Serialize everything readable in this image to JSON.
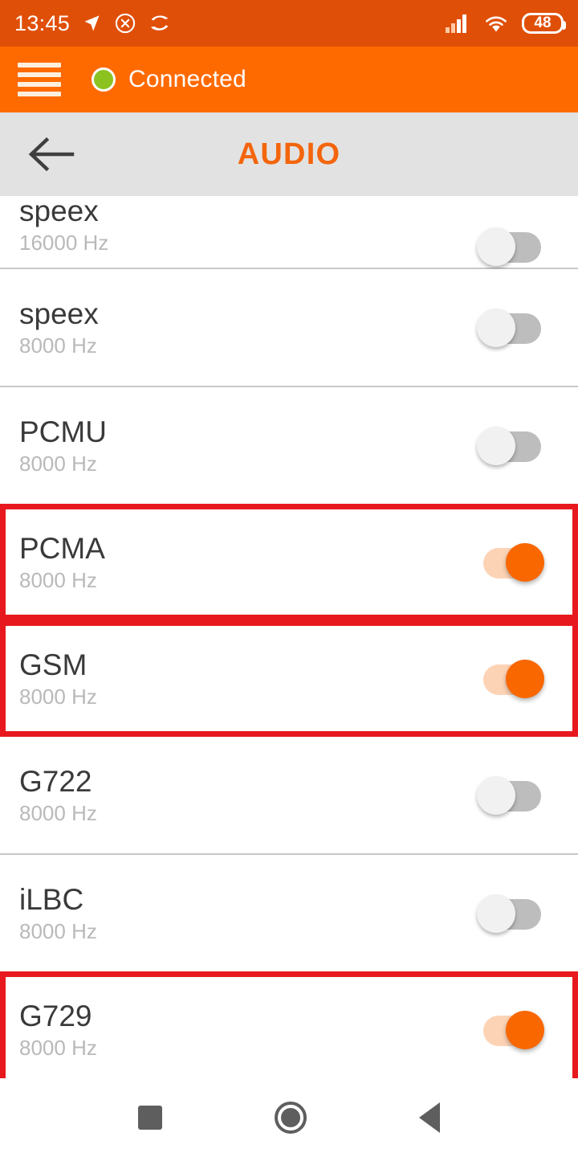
{
  "status_bar": {
    "time": "13:45",
    "left_icons": [
      "location-arrow-icon",
      "cancel-circle-icon",
      "sync-fish-icon"
    ],
    "right_icons": [
      "cellular-signal-icon",
      "wifi-icon"
    ],
    "battery_level": "48",
    "background_color": "#e04f07"
  },
  "app_bar": {
    "menu_icon": "hamburger-menu-icon",
    "connection_status": "Connected",
    "status_dot_color": "#8cc220",
    "background_color": "#ff6a00"
  },
  "title_bar": {
    "back_icon": "arrow-left-icon",
    "title": "AUDIO",
    "title_color": "#f4650c",
    "background_color": "#e2e2e2"
  },
  "highlight_color": "#e8191e",
  "codec_list": [
    {
      "name": "speex",
      "rate": "16000 Hz",
      "enabled": false,
      "highlighted": false,
      "clipped": true
    },
    {
      "name": "speex",
      "rate": "8000 Hz",
      "enabled": false,
      "highlighted": false,
      "clipped": false
    },
    {
      "name": "PCMU",
      "rate": "8000 Hz",
      "enabled": false,
      "highlighted": false,
      "clipped": false
    },
    {
      "name": "PCMA",
      "rate": "8000 Hz",
      "enabled": true,
      "highlighted": true,
      "clipped": false
    },
    {
      "name": "GSM",
      "rate": "8000 Hz",
      "enabled": true,
      "highlighted": true,
      "clipped": false
    },
    {
      "name": "G722",
      "rate": "8000 Hz",
      "enabled": false,
      "highlighted": false,
      "clipped": false
    },
    {
      "name": "iLBC",
      "rate": "8000 Hz",
      "enabled": false,
      "highlighted": false,
      "clipped": false
    },
    {
      "name": "G729",
      "rate": "8000 Hz",
      "enabled": true,
      "highlighted": true,
      "clipped": false
    }
  ],
  "nav_bar": {
    "recents_icon": "square-recents-icon",
    "home_icon": "circle-home-icon",
    "back_icon": "triangle-back-icon"
  }
}
